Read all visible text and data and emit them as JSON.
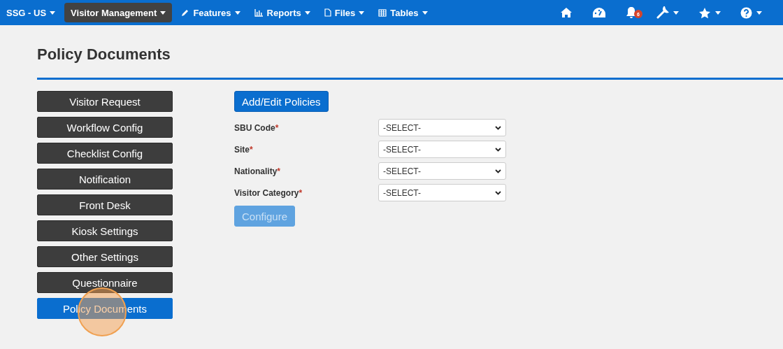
{
  "navbar": {
    "menus": [
      {
        "label": "SSG - US",
        "selected": false
      },
      {
        "label": "Visitor Management",
        "selected": true
      },
      {
        "label": "Features",
        "selected": false
      },
      {
        "label": "Reports",
        "selected": false
      },
      {
        "label": "Files",
        "selected": false
      },
      {
        "label": "Tables",
        "selected": false
      }
    ],
    "notification_badge": "6"
  },
  "page": {
    "title": "Policy Documents"
  },
  "sidebar": {
    "items": [
      {
        "label": "Visitor Request",
        "selected": false
      },
      {
        "label": "Workflow Config",
        "selected": false
      },
      {
        "label": "Checklist Config",
        "selected": false
      },
      {
        "label": "Notification",
        "selected": false
      },
      {
        "label": "Front Desk",
        "selected": false
      },
      {
        "label": "Kiosk Settings",
        "selected": false
      },
      {
        "label": "Other Settings",
        "selected": false
      },
      {
        "label": "Questionnaire",
        "selected": false
      },
      {
        "label": "Policy Documents",
        "selected": true
      }
    ]
  },
  "form": {
    "add_button": "Add/Edit Policies",
    "fields": [
      {
        "label": "SBU Code",
        "required_mark": "*",
        "value": "-SELECT-"
      },
      {
        "label": "Site",
        "required_mark": "*",
        "value": "-SELECT-"
      },
      {
        "label": "Nationality",
        "required_mark": "*",
        "value": "-SELECT-"
      },
      {
        "label": "Visitor Category",
        "required_mark": "*",
        "value": "-SELECT-"
      }
    ],
    "submit": {
      "label": "Configure",
      "disabled": true
    }
  },
  "click_highlight": true
}
